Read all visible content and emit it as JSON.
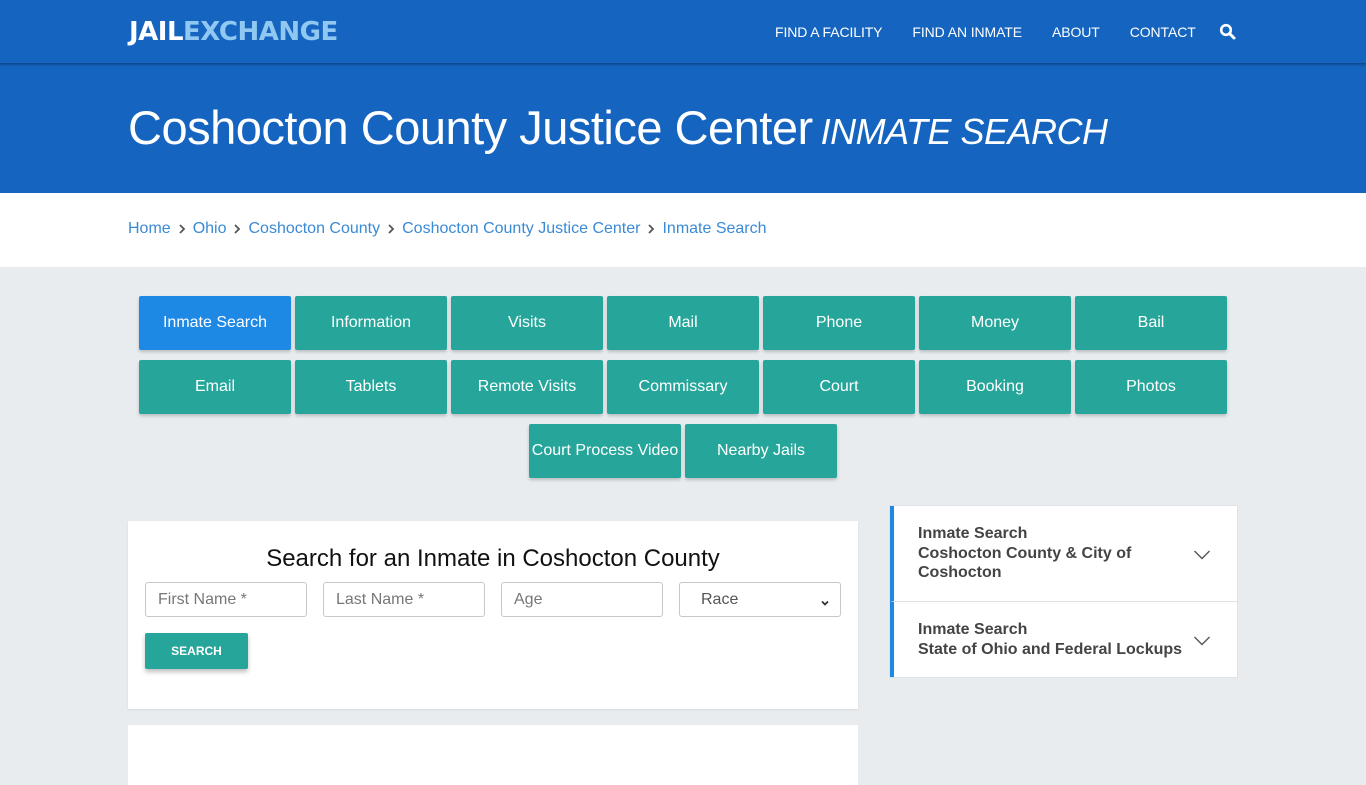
{
  "brand": {
    "part1": "JAIL",
    "part2": "EXCHANGE"
  },
  "nav": {
    "links": [
      "FIND A FACILITY",
      "FIND AN INMATE",
      "ABOUT",
      "CONTACT"
    ],
    "search_icon": "search-icon"
  },
  "hero": {
    "title": "Coshocton County Justice Center",
    "subtitle": "INMATE SEARCH"
  },
  "breadcrumb": [
    "Home",
    "Ohio",
    "Coshocton County",
    "Coshocton County Justice Center",
    "Inmate Search"
  ],
  "tabs": [
    {
      "label": "Inmate Search",
      "active": true
    },
    {
      "label": "Information"
    },
    {
      "label": "Visits"
    },
    {
      "label": "Mail"
    },
    {
      "label": "Phone"
    },
    {
      "label": "Money"
    },
    {
      "label": "Bail"
    },
    {
      "label": "Email"
    },
    {
      "label": "Tablets"
    },
    {
      "label": "Remote Visits"
    },
    {
      "label": "Commissary"
    },
    {
      "label": "Court"
    },
    {
      "label": "Booking"
    },
    {
      "label": "Photos"
    },
    {
      "label": "Court Process Video"
    },
    {
      "label": "Nearby Jails"
    }
  ],
  "search_form": {
    "heading": "Search for an Inmate in Coshocton County",
    "first_name_placeholder": "First Name *",
    "last_name_placeholder": "Last Name *",
    "age_placeholder": "Age",
    "race_selected": "Race",
    "submit_label": "SEARCH"
  },
  "sidebar": {
    "items": [
      {
        "line1": "Inmate Search",
        "line2": "Coshocton County & City of Coshocton"
      },
      {
        "line1": "Inmate Search",
        "line2": "State of Ohio and Federal Lockups"
      }
    ]
  },
  "colors": {
    "primary_blue": "#1565c0",
    "active_tab": "#1e88e5",
    "teal": "#26a69a",
    "link": "#3a8ad6"
  }
}
